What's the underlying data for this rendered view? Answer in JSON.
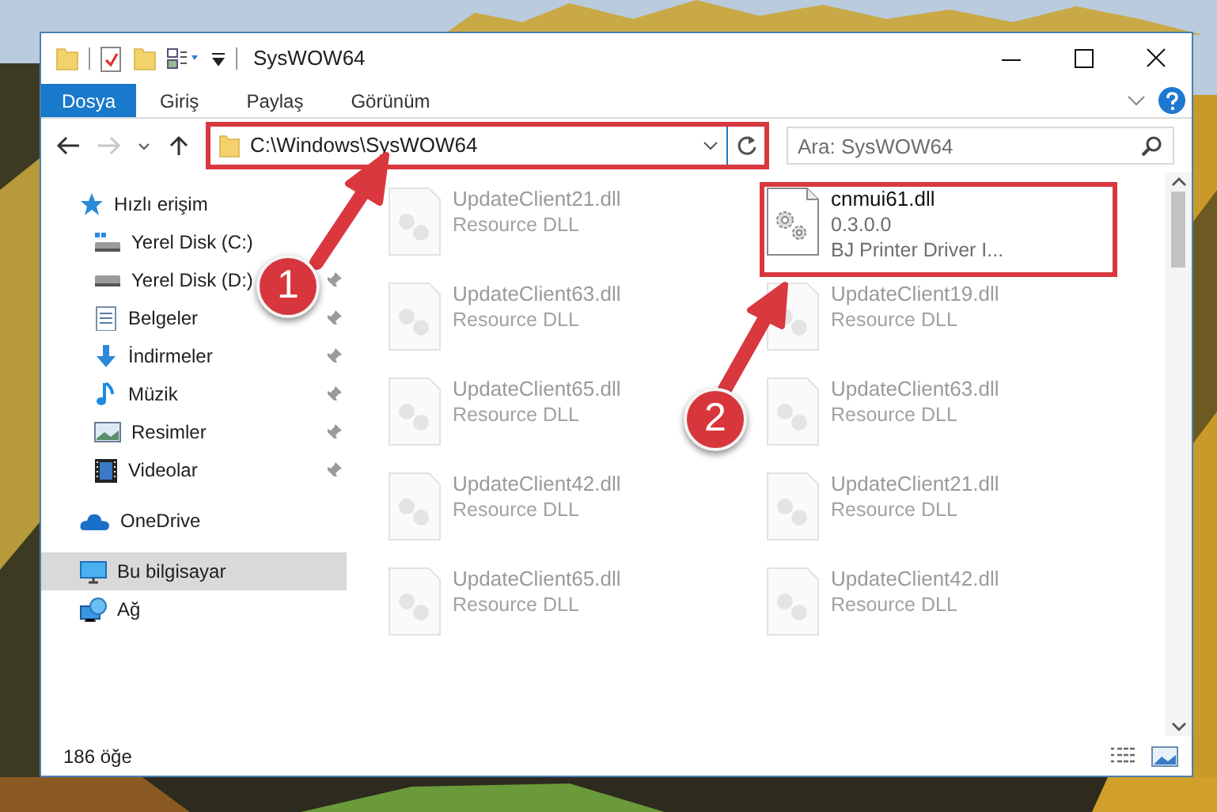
{
  "window": {
    "title": "SysWOW64"
  },
  "ribbon_tabs": [
    {
      "label": "Dosya",
      "selected": true
    },
    {
      "label": "Giriş",
      "selected": false
    },
    {
      "label": "Paylaş",
      "selected": false
    },
    {
      "label": "Görünüm",
      "selected": false
    }
  ],
  "address": {
    "path": "C:\\Windows\\SysWOW64",
    "highlighted": true
  },
  "search": {
    "placeholder": "Ara: SysWOW64"
  },
  "sidebar": {
    "items": [
      {
        "label": "Hızlı erişim",
        "kind": "star",
        "selected": false,
        "children": [
          {
            "label": "Yerel Disk (C:)",
            "kind": "drive_c",
            "pinned": false,
            "selected": false
          },
          {
            "label": "Yerel Disk (D:)",
            "kind": "drive",
            "pinned": true,
            "selected": false
          },
          {
            "label": "Belgeler",
            "kind": "docs",
            "pinned": true,
            "selected": false
          },
          {
            "label": "İndirmeler",
            "kind": "download",
            "pinned": true,
            "selected": false
          },
          {
            "label": "Müzik",
            "kind": "music",
            "pinned": true,
            "selected": false
          },
          {
            "label": "Resimler",
            "kind": "pictures",
            "pinned": true,
            "selected": false
          },
          {
            "label": "Videolar",
            "kind": "videos",
            "pinned": true,
            "selected": false
          }
        ]
      },
      {
        "label": "OneDrive",
        "kind": "cloud",
        "selected": false
      },
      {
        "label": "Bu bilgisayar",
        "kind": "pc",
        "selected": true
      },
      {
        "label": "Ağ",
        "kind": "network",
        "selected": false
      }
    ]
  },
  "files": [
    {
      "lines": [
        "UpdateClient21.dll",
        "Resource DLL"
      ],
      "dimmed": true,
      "highlighted": false
    },
    {
      "lines": [
        "cnmui61.dll",
        "0.3.0.0",
        "BJ Printer Driver I..."
      ],
      "dimmed": false,
      "highlighted": true
    },
    {
      "lines": [
        "UpdateClient63.dll",
        "Resource DLL"
      ],
      "dimmed": true,
      "highlighted": false
    },
    {
      "lines": [
        "UpdateClient19.dll",
        "Resource DLL"
      ],
      "dimmed": true,
      "highlighted": false
    },
    {
      "lines": [
        "UpdateClient65.dll",
        "Resource DLL"
      ],
      "dimmed": true,
      "highlighted": false
    },
    {
      "lines": [
        "UpdateClient63.dll",
        "Resource DLL"
      ],
      "dimmed": true,
      "highlighted": false
    },
    {
      "lines": [
        "UpdateClient42.dll",
        "Resource DLL"
      ],
      "dimmed": true,
      "highlighted": false
    },
    {
      "lines": [
        "UpdateClient21.dll",
        "Resource DLL"
      ],
      "dimmed": true,
      "highlighted": false
    },
    {
      "lines": [
        "UpdateClient65.dll",
        "Resource DLL"
      ],
      "dimmed": true,
      "highlighted": false
    },
    {
      "lines": [
        "UpdateClient42.dll",
        "Resource DLL"
      ],
      "dimmed": true,
      "highlighted": false
    }
  ],
  "status_bar": {
    "item_count": "186 öğe"
  },
  "callouts": [
    {
      "label": "1"
    },
    {
      "label": "2"
    }
  ]
}
